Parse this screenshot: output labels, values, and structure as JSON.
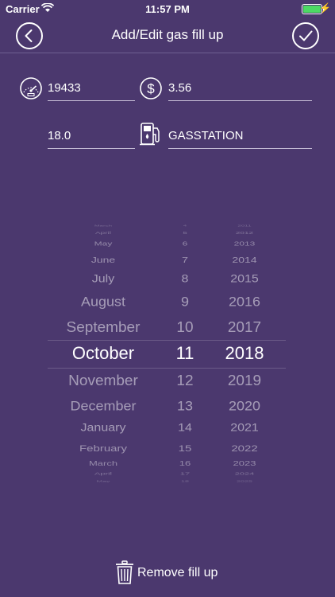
{
  "status_bar": {
    "carrier": "Carrier",
    "time": "11:57 PM",
    "battery_level": 1.0
  },
  "nav": {
    "title": "Add/Edit gas fill up",
    "back_icon": "chevron-left-icon",
    "done_icon": "checkmark-icon"
  },
  "fields": {
    "odometer": {
      "icon": "speedometer-icon",
      "value": "19433"
    },
    "price": {
      "icon": "dollar-icon",
      "value": "3.56"
    },
    "amount": {
      "value": "18.0"
    },
    "station": {
      "icon": "gas-pump-icon",
      "value": "GASSTATION"
    }
  },
  "picker": {
    "months": [
      "March",
      "April",
      "May",
      "June",
      "July",
      "August",
      "September",
      "October",
      "November",
      "December",
      "January",
      "February",
      "March",
      "April",
      "May"
    ],
    "days": [
      "4",
      "5",
      "6",
      "7",
      "8",
      "9",
      "10",
      "11",
      "12",
      "13",
      "14",
      "15",
      "16",
      "17",
      "18"
    ],
    "years": [
      "2011",
      "2012",
      "2013",
      "2014",
      "2015",
      "2016",
      "2017",
      "2018",
      "2019",
      "2020",
      "2021",
      "2022",
      "2023",
      "2024",
      "2025"
    ],
    "selected_index": 7
  },
  "remove": {
    "label": "Remove fill up",
    "icon": "trash-icon"
  },
  "colors": {
    "background": "#4b386e",
    "text": "#ffffff"
  }
}
